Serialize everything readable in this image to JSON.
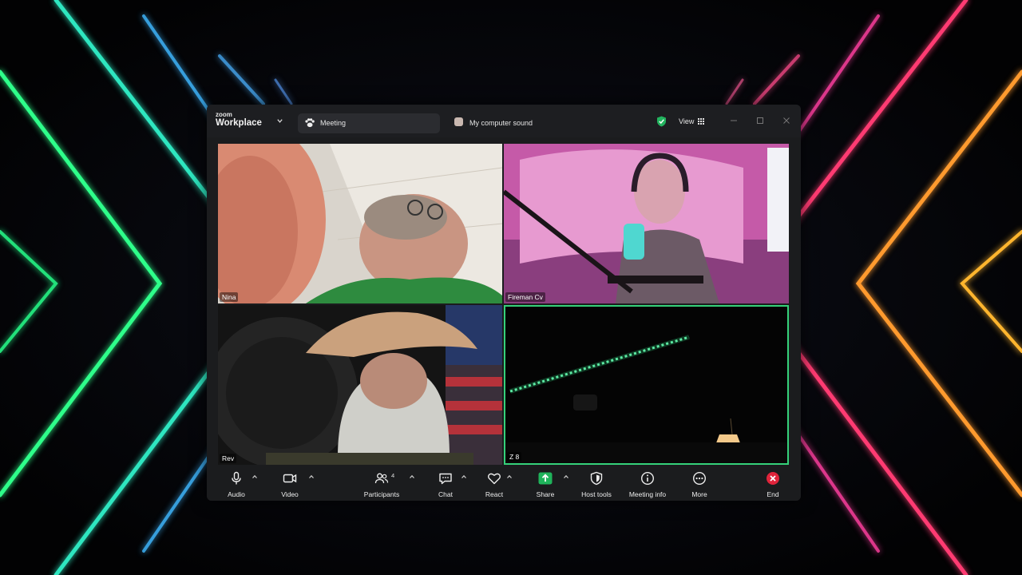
{
  "app": {
    "brand_small": "zoom",
    "brand_name": "Workplace"
  },
  "tabs": {
    "meeting_label": "Meeting",
    "sound_label": "My computer sound"
  },
  "header": {
    "view_label": "View"
  },
  "participants": [
    {
      "name": "Nina"
    },
    {
      "name": "Fireman Cv"
    },
    {
      "name": "Rev"
    },
    {
      "name": "Z 8",
      "active_speaker": true
    }
  ],
  "toolbar": {
    "audio_label": "Audio",
    "video_label": "Video",
    "participants_label": "Participants",
    "participants_count": "4",
    "chat_label": "Chat",
    "react_label": "React",
    "share_label": "Share",
    "host_tools_label": "Host tools",
    "meeting_info_label": "Meeting info",
    "more_label": "More",
    "end_label": "End"
  },
  "colors": {
    "active_speaker_border": "#35d17a",
    "share_green": "#1fb35b",
    "end_red": "#e0243b",
    "shield_green": "#22b35e"
  }
}
